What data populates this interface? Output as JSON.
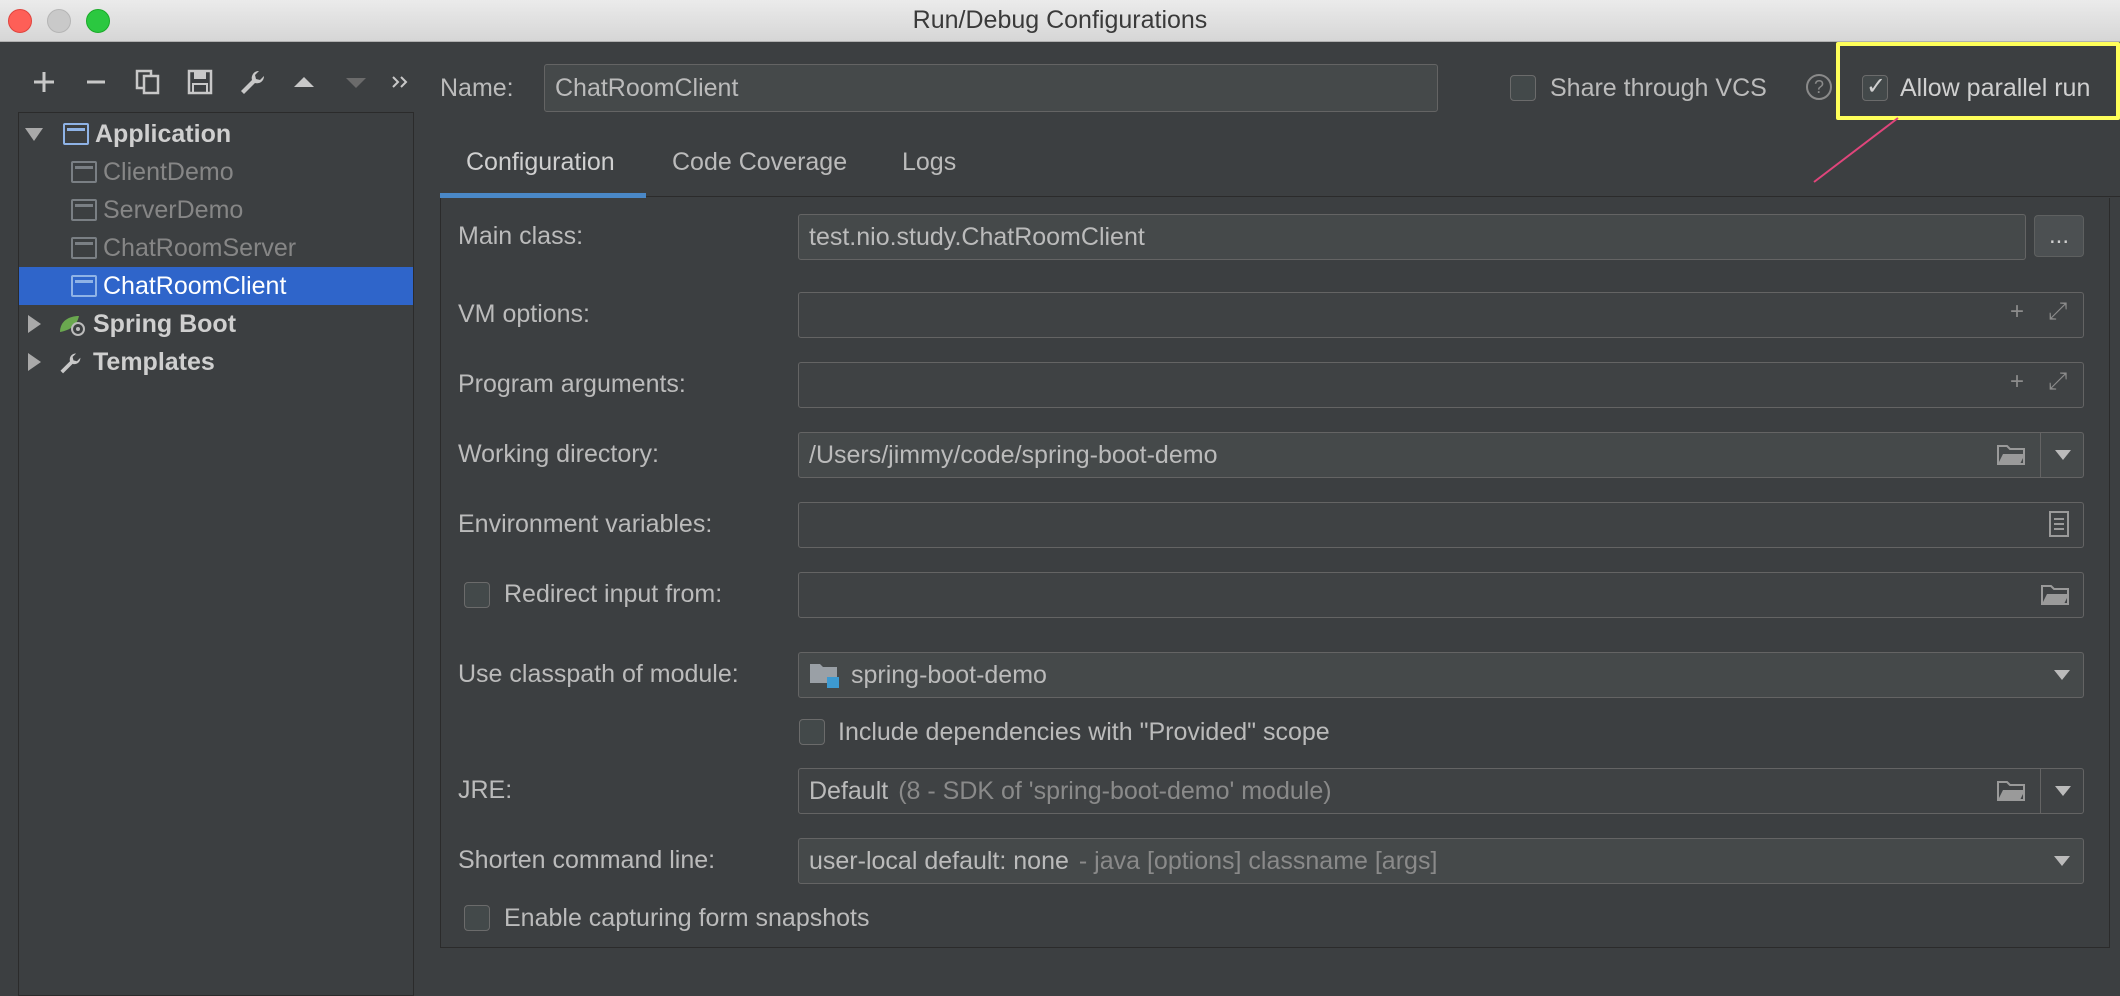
{
  "window": {
    "title": "Run/Debug Configurations"
  },
  "toolbar": {
    "icons": [
      "add-icon",
      "remove-icon",
      "copy-icon",
      "save-icon",
      "wrench-icon",
      "move-up-icon",
      "move-down-icon",
      "more-icon"
    ]
  },
  "tree": {
    "application_label": "Application",
    "items": [
      "ClientDemo",
      "ServerDemo",
      "ChatRoomServer",
      "ChatRoomClient"
    ],
    "selected": "ChatRoomClient",
    "spring_boot_label": "Spring Boot",
    "templates_label": "Templates"
  },
  "header": {
    "name_label": "Name:",
    "name_value": "ChatRoomClient",
    "share_label": "Share through VCS",
    "share_checked": false,
    "help_glyph": "?",
    "parallel_label": "Allow parallel run",
    "parallel_checked": true
  },
  "tabs": [
    {
      "label": "Configuration",
      "active": true
    },
    {
      "label": "Code Coverage",
      "active": false
    },
    {
      "label": "Logs",
      "active": false
    }
  ],
  "form": {
    "main_class_label": "Main class:",
    "main_class_value": "test.nio.study.ChatRoomClient",
    "browse_label": "...",
    "vm_options_label": "VM options:",
    "program_args_label": "Program arguments:",
    "working_dir_label": "Working directory:",
    "working_dir_value": "/Users/jimmy/code/spring-boot-demo",
    "env_vars_label": "Environment variables:",
    "redirect_label": "Redirect input from:",
    "classpath_label": "Use classpath of module:",
    "classpath_value": "spring-boot-demo",
    "include_deps_label": "Include dependencies with \"Provided\" scope",
    "jre_label": "JRE:",
    "jre_value": "Default",
    "jre_hint": "(8 - SDK of 'spring-boot-demo' module)",
    "shorten_label": "Shorten command line:",
    "shorten_value": "user-local default: none",
    "shorten_hint": "- java [options] classname [args]",
    "snapshots_label": "Enable capturing form snapshots"
  },
  "colors": {
    "accent": "#2f65ca",
    "tab_underline": "#4a88c7",
    "highlight": "#ffff5a",
    "annotation_arrow": "#e0457b"
  }
}
